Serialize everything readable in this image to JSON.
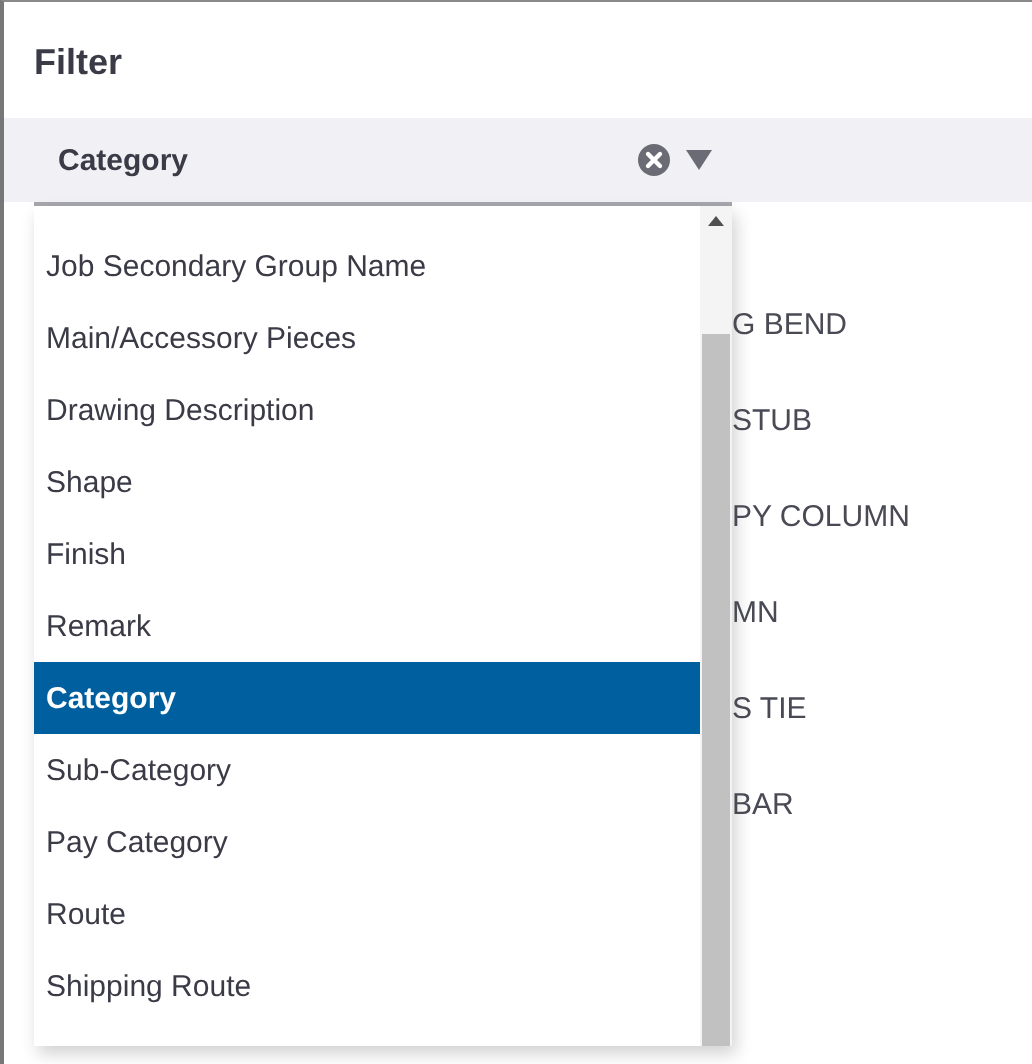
{
  "dialog": {
    "title": "Filter"
  },
  "select": {
    "value": "Category"
  },
  "options": [
    {
      "label": "Job Secondary Group Name",
      "selected": false
    },
    {
      "label": "Main/Accessory Pieces",
      "selected": false
    },
    {
      "label": "Drawing Description",
      "selected": false
    },
    {
      "label": "Shape",
      "selected": false
    },
    {
      "label": "Finish",
      "selected": false
    },
    {
      "label": "Remark",
      "selected": false
    },
    {
      "label": "Category",
      "selected": true
    },
    {
      "label": "Sub-Category",
      "selected": false
    },
    {
      "label": "Pay Category",
      "selected": false
    },
    {
      "label": "Route",
      "selected": false
    },
    {
      "label": "Shipping Route",
      "selected": false
    }
  ],
  "background_rows": [
    "G BEND",
    "STUB",
    "PY COLUMN",
    "MN",
    "S TIE",
    "BAR"
  ]
}
